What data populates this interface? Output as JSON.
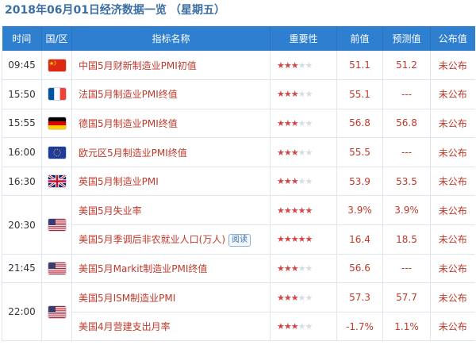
{
  "header": {
    "title": "2018年06月01日经济数据一览",
    "weekday": "（星期五）"
  },
  "table": {
    "columns": [
      "时间",
      "国/区",
      "指标名称",
      "重要性",
      "前值",
      "预测值",
      "公布值"
    ]
  },
  "rows": {
    "r0": {
      "time": "09:45",
      "country_flag": "china-flag-icon",
      "indicator": "中国5月财新制造业PMI初值",
      "importance": 3,
      "previous": "51.1",
      "forecast": "51.2",
      "actual": "未公布"
    },
    "r1": {
      "time": "15:50",
      "country_flag": "france-flag-icon",
      "indicator": "法国5月制造业PMI终值",
      "importance": 3,
      "previous": "55.1",
      "forecast": "---",
      "actual": "未公布"
    },
    "r2": {
      "time": "15:55",
      "country_flag": "germany-flag-icon",
      "indicator": "德国5月制造业PMI终值",
      "importance": 3,
      "previous": "56.8",
      "forecast": "56.8",
      "actual": "未公布"
    },
    "r3": {
      "time": "16:00",
      "country_flag": "eu-flag-icon",
      "indicator": "欧元区5月制造业PMI终值",
      "importance": 3,
      "previous": "55.5",
      "forecast": "---",
      "actual": "未公布"
    },
    "r4": {
      "time": "16:30",
      "country_flag": "uk-flag-icon",
      "indicator": "英国5月制造业PMI",
      "importance": 3,
      "previous": "53.9",
      "forecast": "53.5",
      "actual": "未公布"
    },
    "r5": {
      "time": "20:30",
      "country_flag": "usa-flag-icon",
      "indicator": "美国5月失业率",
      "importance": 5,
      "previous": "3.9%",
      "forecast": "3.9%",
      "actual": "未公布"
    },
    "r6": {
      "indicator": "美国5月季调后非农就业人口(万人)",
      "badge": "阅读",
      "importance": 5,
      "previous": "16.4",
      "forecast": "18.5",
      "actual": "未公布"
    },
    "r7": {
      "time": "21:45",
      "country_flag": "usa-flag-icon",
      "indicator": "美国5月Markit制造业PMI终值",
      "importance": 3,
      "previous": "56.6",
      "forecast": "---",
      "actual": "未公布"
    },
    "r8": {
      "time": "22:00",
      "country_flag": "usa-flag-icon",
      "indicator": "美国5月ISM制造业PMI",
      "importance": 3,
      "previous": "57.3",
      "forecast": "57.7",
      "actual": "未公布"
    },
    "r9": {
      "indicator": "美国4月营建支出月率",
      "importance": 3,
      "previous": "-1.7%",
      "forecast": "1.1%",
      "actual": "未公布"
    }
  },
  "importance_max": 5,
  "colors": {
    "header_bg": "#2f7fd0",
    "value_red": "#c0392b",
    "star_on": "#d64545",
    "star_off": "#d7dbe2",
    "title_blue": "#3a6ea5"
  }
}
